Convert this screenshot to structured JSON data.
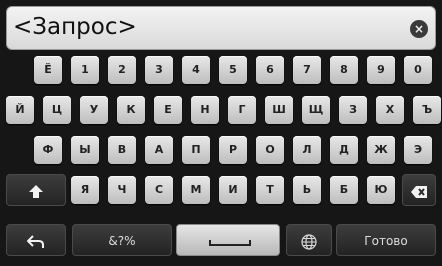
{
  "search": {
    "text": "<Запрос>",
    "clear_icon": "close-icon"
  },
  "rows": [
    [
      "Ё",
      "1",
      "2",
      "3",
      "4",
      "5",
      "6",
      "7",
      "8",
      "9",
      "0"
    ],
    [
      "Й",
      "Ц",
      "У",
      "К",
      "Е",
      "Н",
      "Г",
      "Ш",
      "Щ",
      "З",
      "Х",
      "Ъ"
    ],
    [
      "Ф",
      "Ы",
      "В",
      "А",
      "П",
      "Р",
      "О",
      "Л",
      "Д",
      "Ж",
      "Э"
    ],
    [
      "Я",
      "Ч",
      "С",
      "М",
      "И",
      "Т",
      "Ь",
      "Б",
      "Ю"
    ]
  ],
  "bottom": {
    "symbols_label": "&?%",
    "done_label": "Готово"
  },
  "icons": {
    "shift": "shift-arrow-icon",
    "backspace": "backspace-icon",
    "back": "back-arrow-icon",
    "space": "space-icon",
    "language": "globe-icon"
  }
}
